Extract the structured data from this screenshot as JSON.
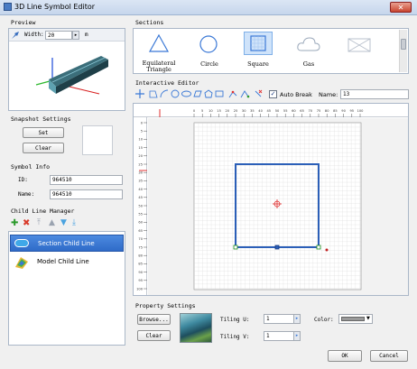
{
  "window": {
    "title": "3D Line Symbol Editor",
    "close_label": "✕"
  },
  "preview": {
    "heading": "Preview",
    "width_label": "Width:",
    "width_value": "20",
    "width_unit": "m"
  },
  "snapshot": {
    "heading": "Snapshot Settings",
    "set_label": "Set",
    "clear_label": "Clear"
  },
  "symbol_info": {
    "heading": "Symbol Info",
    "id_label": "ID:",
    "id_value": "964510",
    "name_label": "Name:",
    "name_value": "964510"
  },
  "child_manager": {
    "heading": "Child Line Manager",
    "items": [
      {
        "label": "Section Child Line",
        "selected": true
      },
      {
        "label": "Model Child Line",
        "selected": false
      }
    ]
  },
  "sections": {
    "heading": "Sections",
    "items": [
      {
        "label": "Equilateral Triangle",
        "icon": "triangle-icon"
      },
      {
        "label": "Circle",
        "icon": "circle-icon"
      },
      {
        "label": "Square",
        "icon": "square-icon",
        "selected": true
      },
      {
        "label": "Gas",
        "icon": "cloud-icon"
      },
      {
        "label": "",
        "icon": "envelope-icon"
      }
    ]
  },
  "editor": {
    "heading": "Interactive Editor",
    "auto_break_label": "Auto Break",
    "auto_break_checked": true,
    "name_label": "Name:",
    "name_value": "13",
    "h_ticks": [
      "0",
      "5",
      "10",
      "15",
      "20",
      "25",
      "30",
      "35",
      "40",
      "45",
      "50",
      "55",
      "60",
      "65",
      "70",
      "75",
      "80",
      "85",
      "90",
      "95",
      "100"
    ],
    "v_ticks": [
      "0",
      "5",
      "10",
      "15",
      "20",
      "25",
      "30",
      "35",
      "40",
      "45",
      "50",
      "55",
      "60",
      "65",
      "70",
      "75",
      "80",
      "85",
      "90",
      "95",
      "100"
    ]
  },
  "property": {
    "heading": "Property Settings",
    "browse_label": "Browse...",
    "clear_label": "Clear",
    "tiling_u_label": "Tiling U:",
    "tiling_u_value": "1",
    "tiling_v_label": "Tiling V:",
    "tiling_v_value": "1",
    "color_label": "Color:"
  },
  "footer": {
    "ok_label": "OK",
    "cancel_label": "Cancel"
  },
  "colors": {
    "accent": "#2b5fb8",
    "selection": "#3a78d6",
    "handle": "#1a8a1a",
    "axis_line": "#2e3f99",
    "marker": "#e03030"
  }
}
